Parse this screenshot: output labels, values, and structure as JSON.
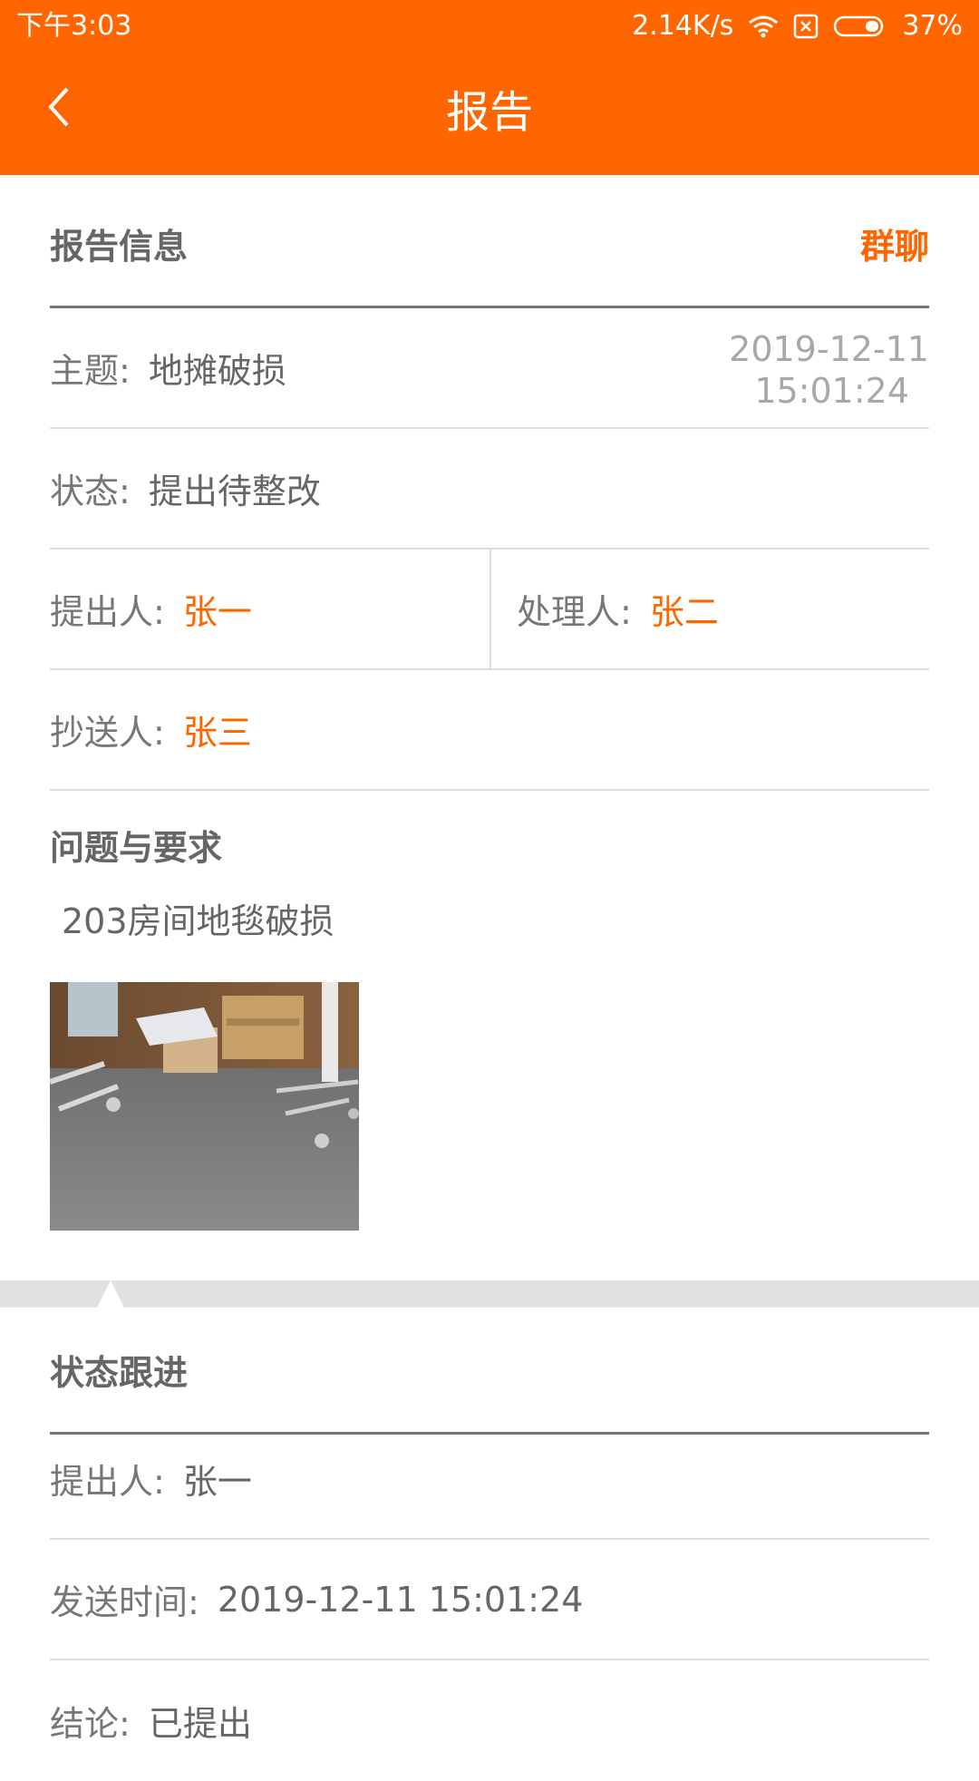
{
  "status_bar": {
    "time": "下午3:03",
    "speed": "2.14K/s",
    "battery": "37%"
  },
  "header": {
    "title": "报告"
  },
  "report_info": {
    "section_title": "报告信息",
    "group_chat": "群聊",
    "subject_label": "主题:",
    "subject_value": "地摊破损",
    "date": "2019-12-11",
    "time": "15:01:24",
    "status_label": "状态:",
    "status_value": "提出待整改",
    "proposer_label": "提出人:",
    "proposer_value": "张一",
    "handler_label": "处理人:",
    "handler_value": "张二",
    "cc_label": "抄送人:",
    "cc_value": "张三"
  },
  "issue": {
    "title": "问题与要求",
    "description": "203房间地毯破损"
  },
  "follow_up": {
    "section_title": "状态跟进",
    "proposer_label": "提出人:",
    "proposer_value": "张一",
    "send_time_label": "发送时间:",
    "send_time_value": "2019-12-11 15:01:24",
    "conclusion_label": "结论:",
    "conclusion_value": "已提出"
  },
  "colors": {
    "accent": "#ff6600",
    "text": "#666666",
    "muted": "#a8a8a8",
    "divider": "#dddddd"
  }
}
